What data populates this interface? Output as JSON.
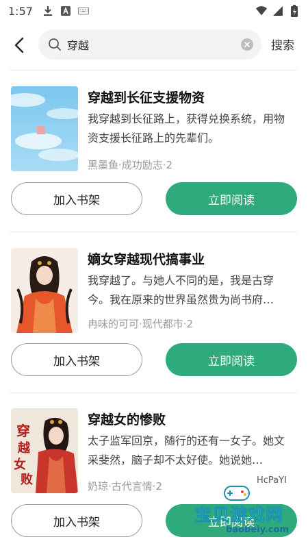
{
  "status_bar": {
    "time": "1:57"
  },
  "search": {
    "query": "穿越",
    "submit_label": "搜索"
  },
  "books": [
    {
      "title": "穿越到长征支援物资",
      "description": "我穿越到长征路上，获得兑换系统，用物资支援长征路上的先辈们。",
      "meta": "黑墨鱼·成功励志·2",
      "add_label": "加入书架",
      "read_label": "立即阅读"
    },
    {
      "title": "嫡女穿越现代搞事业",
      "description": "我穿越了。与她人不同的是，我是古穿今。我在原来的世界虽然贵为尚书府…",
      "meta": "冉味的可可·现代都市·2",
      "add_label": "加入书架",
      "read_label": "立即阅读"
    },
    {
      "title": "穿越女的惨败",
      "description": "太子监军回京，随行的还有一女子。她文采斐然，脑子却不太好使。她说她…",
      "meta": "奶琼·古代言情·2",
      "add_label": "加入书架",
      "read_label": "立即阅读"
    }
  ],
  "watermark": {
    "code": "HcPaYI",
    "site_name": "宝贝游戏网",
    "site_url": "baobeiy.com"
  },
  "colors": {
    "accent": "#2eaa7c",
    "search_bg": "#f3f3f3"
  }
}
